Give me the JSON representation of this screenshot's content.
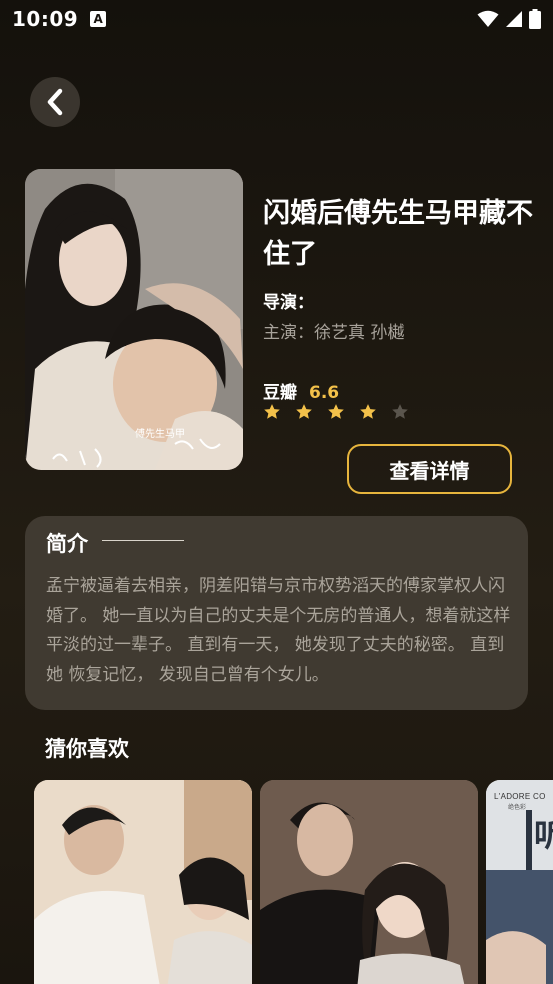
{
  "status_bar": {
    "time": "10:09",
    "notification_icon_text": "A"
  },
  "movie": {
    "title": "闪婚后傅先生马甲藏不住了",
    "director": "导演：",
    "cast": "主演：徐艺真 孙樾",
    "rating_label": "豆瓣",
    "rating_score": "6.6",
    "stars_filled": 4,
    "stars_total": 5,
    "poster_caption": "傅先生马甲"
  },
  "actions": {
    "detail_button": "查看详情"
  },
  "intro": {
    "title": "简介",
    "text": "孟宁被逼着去相亲，阴差阳错与京市权势滔天的傅家掌权人闪 婚了。 她一直以为自己的丈夫是个无房的普通人，想着就这样 平淡的过一辈子。 直到有一天， 她发现了丈夫的秘密。 直到她 恢复记忆， 发现自己曾有个女儿。"
  },
  "recommendations": {
    "title": "猜你喜欢",
    "card3_brand": "L'ADORE CO",
    "card3_sub": "绝色彩",
    "card3_glyph": "听"
  },
  "colors": {
    "accent": "#e7b53d",
    "star_active": "#f3c14a",
    "star_inactive": "#5a554d",
    "card_bg": "#403a31",
    "muted_text": "#aaa49a"
  },
  "icons": {
    "back": "chevron-left-icon",
    "wifi": "wifi-icon",
    "signal": "signal-icon",
    "battery": "battery-icon",
    "star": "star-icon"
  }
}
